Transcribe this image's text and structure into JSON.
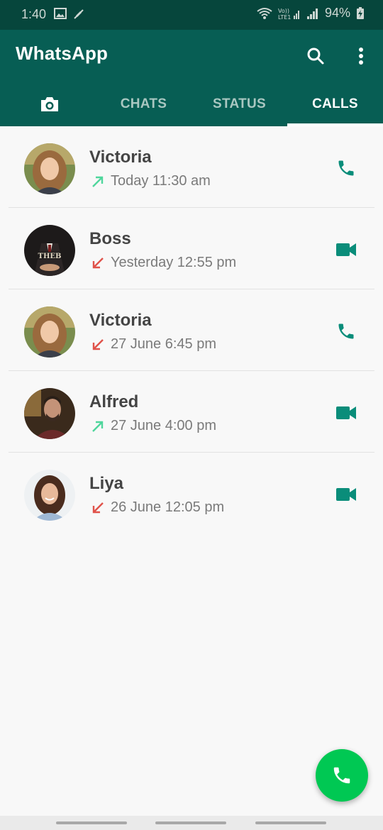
{
  "status_bar": {
    "time": "1:40",
    "battery": "94%"
  },
  "app_bar": {
    "title": "WhatsApp",
    "color": "#075e54"
  },
  "tabs": [
    {
      "label": "",
      "icon": "camera-icon"
    },
    {
      "label": "CHATS"
    },
    {
      "label": "STATUS"
    },
    {
      "label": "CALLS",
      "selected": true
    }
  ],
  "calls": [
    {
      "name": "Victoria",
      "time": "Today 11:30 am",
      "direction": "outgoing",
      "type": "voice"
    },
    {
      "name": "Boss",
      "time": "Yesterday 12:55 pm",
      "direction": "incoming-missed",
      "type": "video"
    },
    {
      "name": "Victoria",
      "time": "27 June 6:45 pm",
      "direction": "incoming-missed",
      "type": "voice"
    },
    {
      "name": "Alfred",
      "time": "27 June 4:00 pm",
      "direction": "outgoing",
      "type": "video"
    },
    {
      "name": "Liya",
      "time": "26 June 12:05 pm",
      "direction": "incoming-missed",
      "type": "video"
    }
  ],
  "colors": {
    "outgoing_arrow": "#4fd69c",
    "missed_arrow": "#e0524a",
    "action_icon": "#0a8d7a",
    "fab": "#00c853"
  }
}
